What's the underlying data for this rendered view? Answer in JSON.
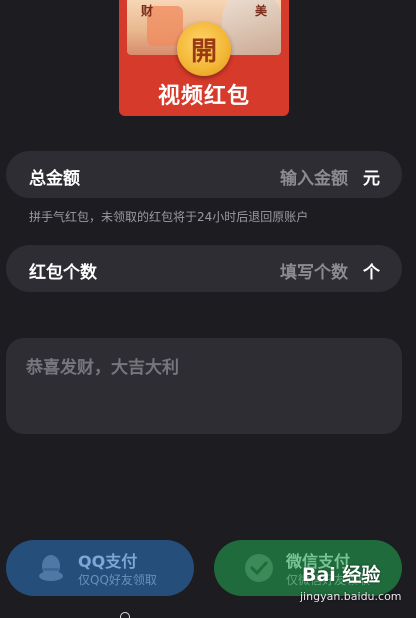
{
  "envelope": {
    "corner_left": "财",
    "corner_right": "美",
    "open_char": "開",
    "title": "视频红包"
  },
  "amount_row": {
    "label": "总金额",
    "placeholder": "输入金额",
    "unit": "元"
  },
  "hint": "拼手气红包，未领取的红包将于24小时后退回原账户",
  "count_row": {
    "label": "红包个数",
    "placeholder": "填写个数",
    "unit": "个"
  },
  "greeting": {
    "placeholder": "恭喜发财，大吉大利"
  },
  "payments": {
    "qq": {
      "title": "QQ支付",
      "subtitle": "仅QQ好友领取",
      "color": "#264e7a"
    },
    "wechat": {
      "title": "微信支付",
      "subtitle": "仅微信好友领取",
      "color": "#1f6b3c"
    }
  },
  "watermark": {
    "logo": "Bai 经验",
    "url": "jingyan.baidu.com"
  },
  "colors": {
    "background": "#1c1c21",
    "field": "#2d2d33",
    "envelope_red": "#d63a2a",
    "gold": "#f2b634"
  }
}
